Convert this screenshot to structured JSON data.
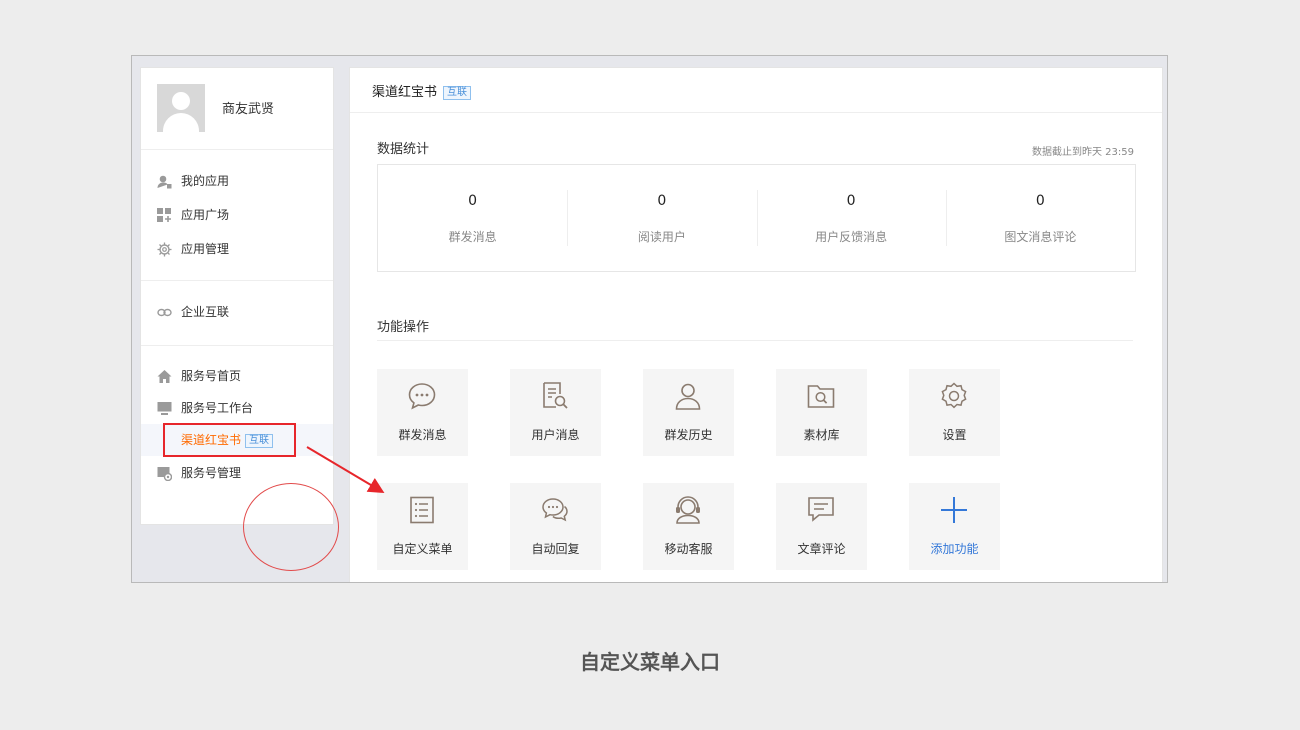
{
  "sidebar": {
    "user_name": "商友武贤",
    "items": [
      {
        "label": "我的应用",
        "icon": "user-apps-icon"
      },
      {
        "label": "应用广场",
        "icon": "app-grid-icon"
      },
      {
        "label": "应用管理",
        "icon": "gear-icon"
      },
      {
        "label": "企业互联",
        "icon": "link-icon"
      },
      {
        "label": "服务号首页",
        "icon": "home-icon"
      },
      {
        "label": "服务号工作台",
        "icon": "monitor-icon"
      },
      {
        "label": "渠道红宝书",
        "tag": "互联",
        "active": true
      },
      {
        "label": "服务号管理",
        "icon": "settings-window-icon"
      }
    ]
  },
  "main": {
    "title": "渠道红宝书",
    "title_tag": "互联",
    "stats_title": "数据统计",
    "updated_at": "数据截止到昨天 23:59",
    "stats": [
      {
        "value": "0",
        "label": "群发消息"
      },
      {
        "value": "0",
        "label": "阅读用户"
      },
      {
        "value": "0",
        "label": "用户反馈消息"
      },
      {
        "value": "0",
        "label": "图文消息评论"
      }
    ],
    "ops_title": "功能操作",
    "tiles": [
      {
        "label": "群发消息",
        "icon": "chat-bubble-icon"
      },
      {
        "label": "用户消息",
        "icon": "document-search-icon"
      },
      {
        "label": "群发历史",
        "icon": "person-icon"
      },
      {
        "label": "素材库",
        "icon": "folder-search-icon"
      },
      {
        "label": "设置",
        "icon": "gear-icon"
      },
      {
        "label": "自定义菜单",
        "icon": "list-icon"
      },
      {
        "label": "自动回复",
        "icon": "chat-bubbles-icon"
      },
      {
        "label": "移动客服",
        "icon": "headset-icon"
      },
      {
        "label": "文章评论",
        "icon": "comment-icon"
      },
      {
        "label": "添加功能",
        "icon": "plus-icon"
      }
    ]
  },
  "caption": "自定义菜单入口",
  "colors": {
    "active": "#ff6a00",
    "highlight": "#e7262b",
    "link": "#3478d8"
  }
}
